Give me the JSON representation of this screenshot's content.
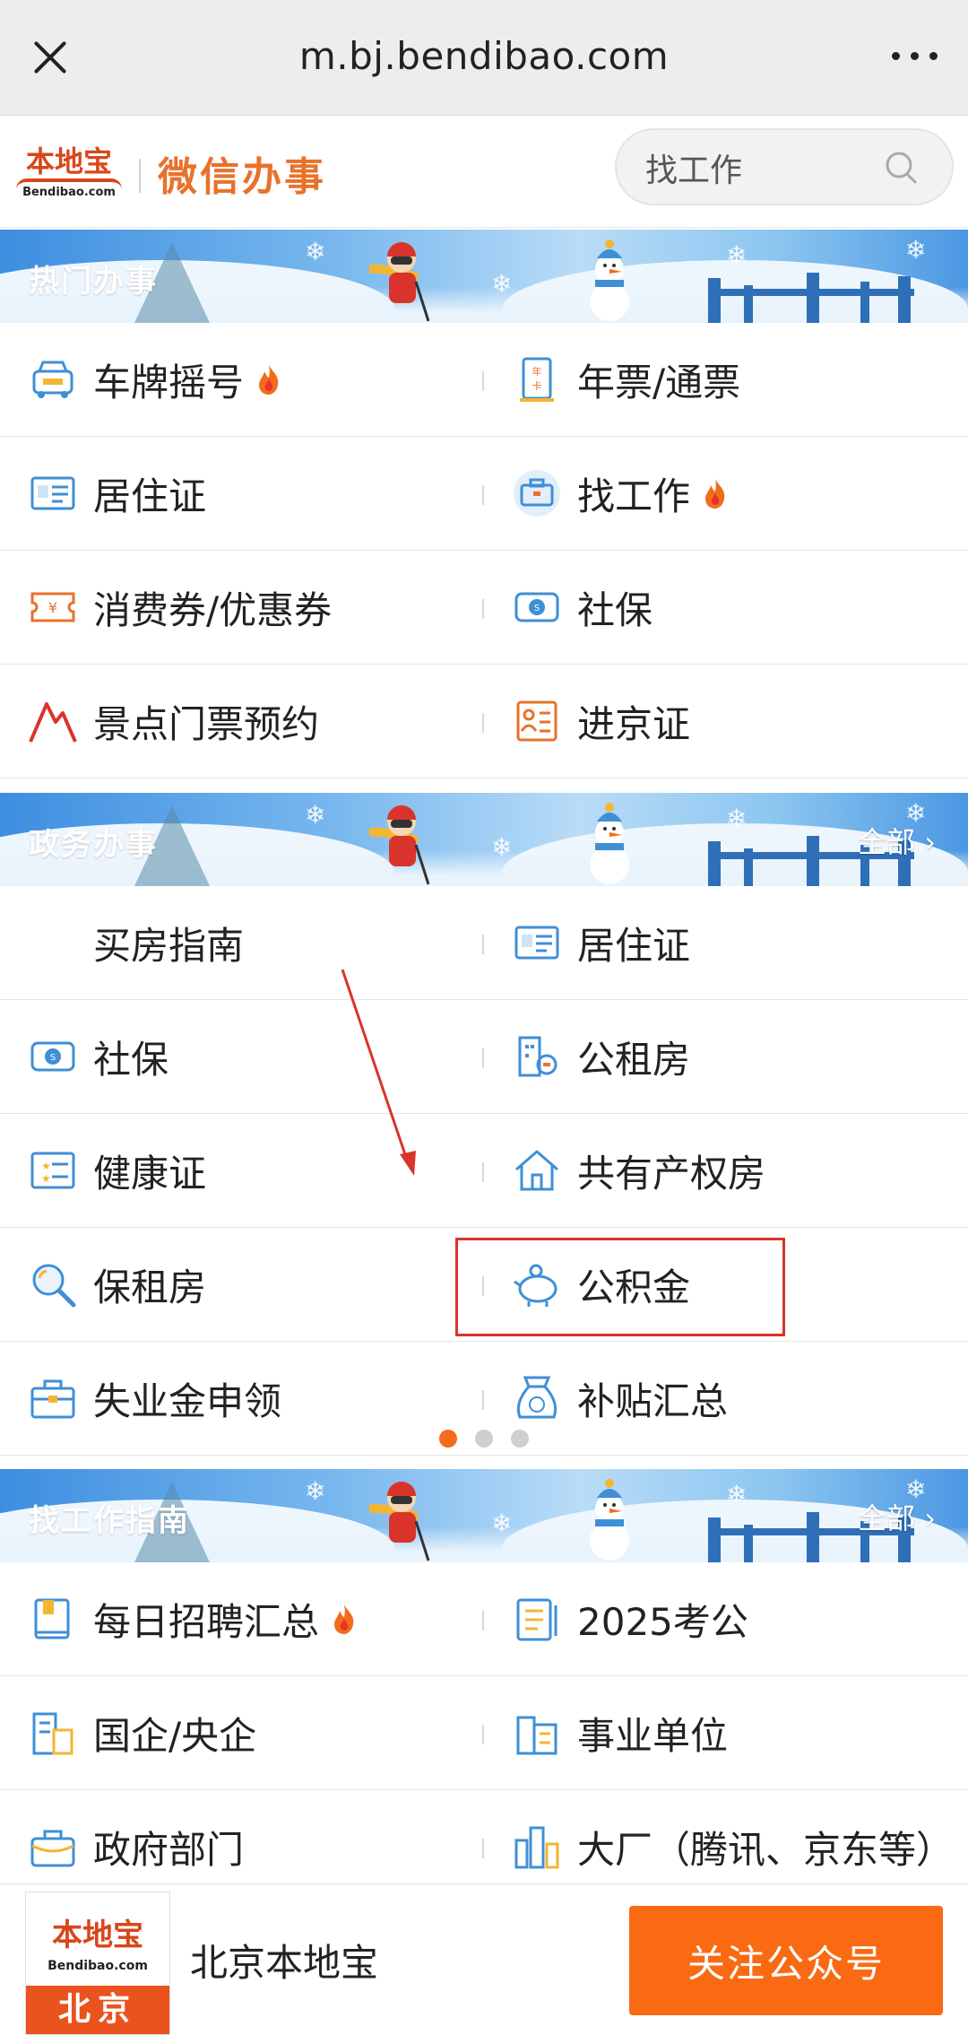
{
  "browser": {
    "url": "m.bj.bendibao.com",
    "close": "close",
    "more": "more"
  },
  "header": {
    "logo_cn": "本地宝",
    "logo_en": "Bendibao.com",
    "title": "微信办事",
    "search_placeholder": "找工作"
  },
  "sections": [
    {
      "title": "热门办事",
      "all_label": "",
      "items": [
        {
          "label": "车牌摇号",
          "icon": "car-icon",
          "hot": true
        },
        {
          "label": "年票/通票",
          "icon": "annual-card-icon",
          "hot": false
        },
        {
          "label": "居住证",
          "icon": "id-card-icon",
          "hot": false
        },
        {
          "label": "找工作",
          "icon": "briefcase-icon",
          "hot": true
        },
        {
          "label": "消费券/优惠券",
          "icon": "coupon-icon",
          "hot": false
        },
        {
          "label": "社保",
          "icon": "social-security-icon",
          "hot": false
        },
        {
          "label": "景点门票预约",
          "icon": "mountain-icon",
          "hot": false
        },
        {
          "label": "进京证",
          "icon": "pass-card-icon",
          "hot": false
        }
      ]
    },
    {
      "title": "政务办事",
      "all_label": "全部",
      "items": [
        {
          "label": "买房指南",
          "icon": "",
          "hot": false
        },
        {
          "label": "居住证",
          "icon": "id-card-icon",
          "hot": false
        },
        {
          "label": "社保",
          "icon": "social-security-icon",
          "hot": false
        },
        {
          "label": "公租房",
          "icon": "building-icon",
          "hot": false
        },
        {
          "label": "健康证",
          "icon": "health-card-icon",
          "hot": false
        },
        {
          "label": "共有产权房",
          "icon": "house-icon",
          "hot": false
        },
        {
          "label": "保租房",
          "icon": "magnifier-icon",
          "hot": false
        },
        {
          "label": "公积金",
          "icon": "piggy-bank-icon",
          "hot": false
        },
        {
          "label": "失业金申领",
          "icon": "toolbox-icon",
          "hot": false
        },
        {
          "label": "补贴汇总",
          "icon": "money-bag-icon",
          "hot": false
        }
      ],
      "pager": {
        "pages": 3,
        "active": 1
      }
    },
    {
      "title": "找工作指南",
      "all_label": "全部",
      "items": [
        {
          "label": "每日招聘汇总",
          "icon": "book-icon",
          "hot": true
        },
        {
          "label": "2025考公",
          "icon": "document-icon",
          "hot": false
        },
        {
          "label": "国企/央企",
          "icon": "enterprise-icon",
          "hot": false
        },
        {
          "label": "事业单位",
          "icon": "office-icon",
          "hot": false
        },
        {
          "label": "政府部门",
          "icon": "bag-icon",
          "hot": false
        },
        {
          "label": "大厂（腾讯、京东等）",
          "icon": "towers-icon",
          "hot": false
        }
      ]
    }
  ],
  "footer": {
    "logo_cn": "本地宝",
    "logo_en": "Bendibao.com",
    "city": "北京",
    "account_name": "北京本地宝",
    "follow_label": "关注公众号"
  },
  "colors": {
    "accent": "#fa6a13",
    "brand": "#e8722b",
    "highlight": "#d9342b",
    "icon_blue": "#3f8fd6"
  }
}
